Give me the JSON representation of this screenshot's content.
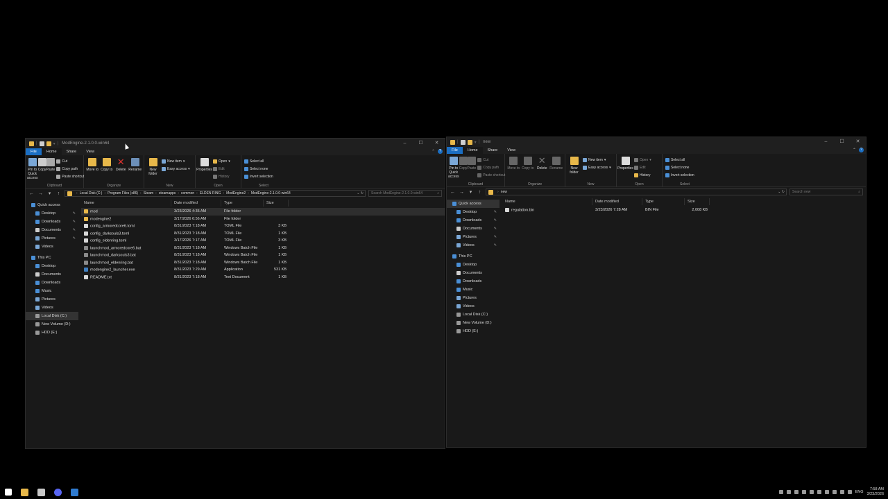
{
  "colors": {
    "file_tab": "#1b6ec2",
    "folder": "#e8b84a",
    "background": "#191919",
    "desktop": "#000000"
  },
  "left_window": {
    "title": "ModEngine-2.1.0.0-win64",
    "menu_tabs": [
      "File",
      "Home",
      "Share",
      "View"
    ],
    "ribbon": {
      "clipboard": {
        "label": "Clipboard",
        "pin": "Pin to Quick access",
        "copy": "Copy",
        "paste": "Paste",
        "cut": "Cut",
        "copy_path": "Copy path",
        "paste_shortcut": "Paste shortcut"
      },
      "organize": {
        "label": "Organize",
        "move_to": "Move to",
        "copy_to": "Copy to",
        "delete": "Delete",
        "rename": "Rename"
      },
      "new": {
        "label": "New",
        "new_folder": "New folder",
        "new_item": "New item",
        "easy_access": "Easy access"
      },
      "open": {
        "label": "Open",
        "properties": "Properties",
        "open": "Open",
        "edit": "Edit",
        "history": "History"
      },
      "select": {
        "label": "Select",
        "select_all": "Select all",
        "select_none": "Select none",
        "invert": "Invert selection"
      }
    },
    "breadcrumbs": [
      "Local Disk (C:)",
      "Program Files (x86)",
      "Steam",
      "steamapps",
      "common",
      "ELDEN RING",
      "ModEngine2",
      "ModEngine-2.1.0.0-win64"
    ],
    "search_placeholder": "Search ModEngine-2.1.0.0-win64",
    "nav": {
      "quick_access": "Quick access",
      "quick": [
        "Desktop",
        "Downloads",
        "Documents",
        "Pictures",
        "Videos"
      ],
      "this_pc": "This PC",
      "pc": [
        "Desktop",
        "Documents",
        "Downloads",
        "Music",
        "Pictures",
        "Videos",
        "Local Disk (C:)",
        "New Volume (D:)",
        "HDD (E:)"
      ]
    },
    "columns": [
      "Name",
      "Date modified",
      "Type",
      "Size"
    ],
    "files": [
      {
        "name": "mod",
        "date": "3/23/2026 4:35 AM",
        "type": "File folder",
        "size": "",
        "kind": "folder"
      },
      {
        "name": "modengine2",
        "date": "3/17/2026 6:56 AM",
        "type": "File folder",
        "size": "",
        "kind": "folder"
      },
      {
        "name": "config_armoredcore6.toml",
        "date": "8/31/2023 7:18 AM",
        "type": "TOML File",
        "size": "3 KB",
        "kind": "file"
      },
      {
        "name": "config_darksouls3.toml",
        "date": "8/31/2023 7:18 AM",
        "type": "TOML File",
        "size": "1 KB",
        "kind": "file"
      },
      {
        "name": "config_eldenring.toml",
        "date": "3/17/2026 7:17 AM",
        "type": "TOML File",
        "size": "3 KB",
        "kind": "file"
      },
      {
        "name": "launchmod_armoredcore6.bat",
        "date": "8/31/2023 7:18 AM",
        "type": "Windows Batch File",
        "size": "1 KB",
        "kind": "bat"
      },
      {
        "name": "launchmod_darksouls3.bat",
        "date": "8/31/2023 7:18 AM",
        "type": "Windows Batch File",
        "size": "1 KB",
        "kind": "bat"
      },
      {
        "name": "launchmod_eldenring.bat",
        "date": "8/31/2023 7:18 AM",
        "type": "Windows Batch File",
        "size": "1 KB",
        "kind": "bat"
      },
      {
        "name": "modengine2_launcher.exe",
        "date": "8/31/2023 7:29 AM",
        "type": "Application",
        "size": "531 KB",
        "kind": "exe"
      },
      {
        "name": "README.txt",
        "date": "8/31/2023 7:18 AM",
        "type": "Text Document",
        "size": "1 KB",
        "kind": "file"
      }
    ]
  },
  "right_window": {
    "title": "new",
    "menu_tabs": [
      "File",
      "Home",
      "Share",
      "View"
    ],
    "breadcrumbs": [
      "new"
    ],
    "search_placeholder": "Search new",
    "nav": {
      "quick_access": "Quick access",
      "quick": [
        "Desktop",
        "Downloads",
        "Documents",
        "Pictures",
        "Videos"
      ],
      "this_pc": "This PC",
      "pc": [
        "Desktop",
        "Documents",
        "Downloads",
        "Music",
        "Pictures",
        "Videos",
        "Local Disk (C:)",
        "New Volume (D:)",
        "HDD (E:)"
      ]
    },
    "columns": [
      "Name",
      "Date modified",
      "Type",
      "Size"
    ],
    "files": [
      {
        "name": "regulation.bin",
        "date": "3/23/2026 7:28 AM",
        "type": "BIN File",
        "size": "2,008 KB",
        "kind": "file"
      }
    ]
  },
  "taskbar": {
    "lang": "ENG",
    "time": "7:58 AM",
    "date": "3/23/2026"
  }
}
